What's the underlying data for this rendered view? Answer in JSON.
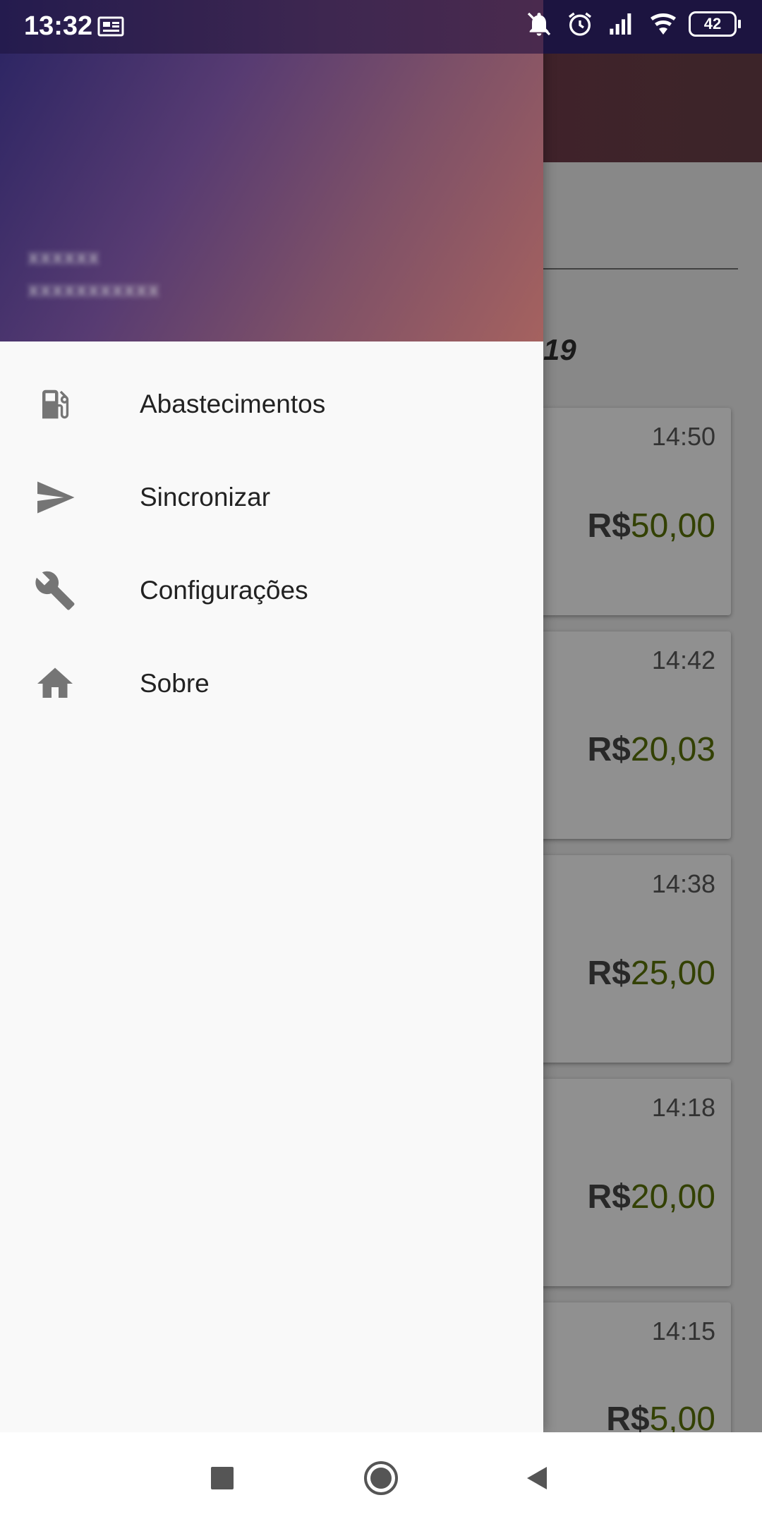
{
  "status_bar": {
    "time": "13:32",
    "battery_level": "42",
    "icons": [
      "news-icon",
      "bell-muted-icon",
      "alarm-icon",
      "signal-icon",
      "wifi-icon",
      "battery-icon"
    ]
  },
  "drawer": {
    "header": {
      "user_name": "xxxxxx",
      "user_email": "xxxxxxxxxxx"
    },
    "items": [
      {
        "label": "Abastecimentos",
        "icon": "fuel-pump-icon"
      },
      {
        "label": "Sincronizar",
        "icon": "send-icon"
      },
      {
        "label": "Configurações",
        "icon": "wrench-icon"
      },
      {
        "label": "Sobre",
        "icon": "home-icon"
      }
    ]
  },
  "background": {
    "date_header_visible": "19",
    "cards": [
      {
        "time": "14:50",
        "currency": "R$",
        "value": "50,00"
      },
      {
        "time": "14:42",
        "currency": "R$",
        "value": "20,03"
      },
      {
        "time": "14:38",
        "currency": "R$",
        "value": "25,00"
      },
      {
        "time": "14:18",
        "currency": "R$",
        "value": "20,00"
      },
      {
        "time": "14:15",
        "currency": "R$",
        "value": "5,00"
      }
    ]
  },
  "colors": {
    "drawer_header_gradient": [
      "#2e2664",
      "#a5625f"
    ],
    "value_green": "#3b4a05",
    "icon_gray": "#757575"
  }
}
